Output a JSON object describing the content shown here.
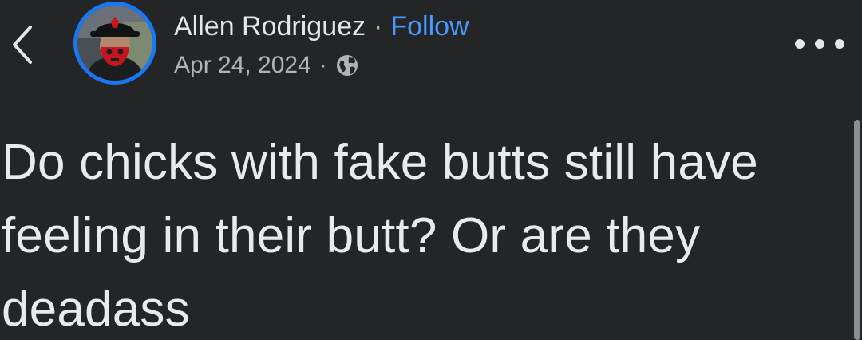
{
  "post": {
    "author": "Allen Rodriguez",
    "separator": "·",
    "follow_label": "Follow",
    "date": "Apr 24, 2024",
    "audience_icon": "globe-icon",
    "text": "Do chicks with fake butts still have feeling in their butt? Or are they deadass"
  },
  "icons": {
    "back": "chevron-left-icon",
    "more": "more-horizontal-icon"
  },
  "colors": {
    "background": "#242526",
    "text_primary": "#e4e6eb",
    "text_secondary": "#b0b3b8",
    "link": "#4599ff",
    "avatar_ring": "#1877f2"
  }
}
